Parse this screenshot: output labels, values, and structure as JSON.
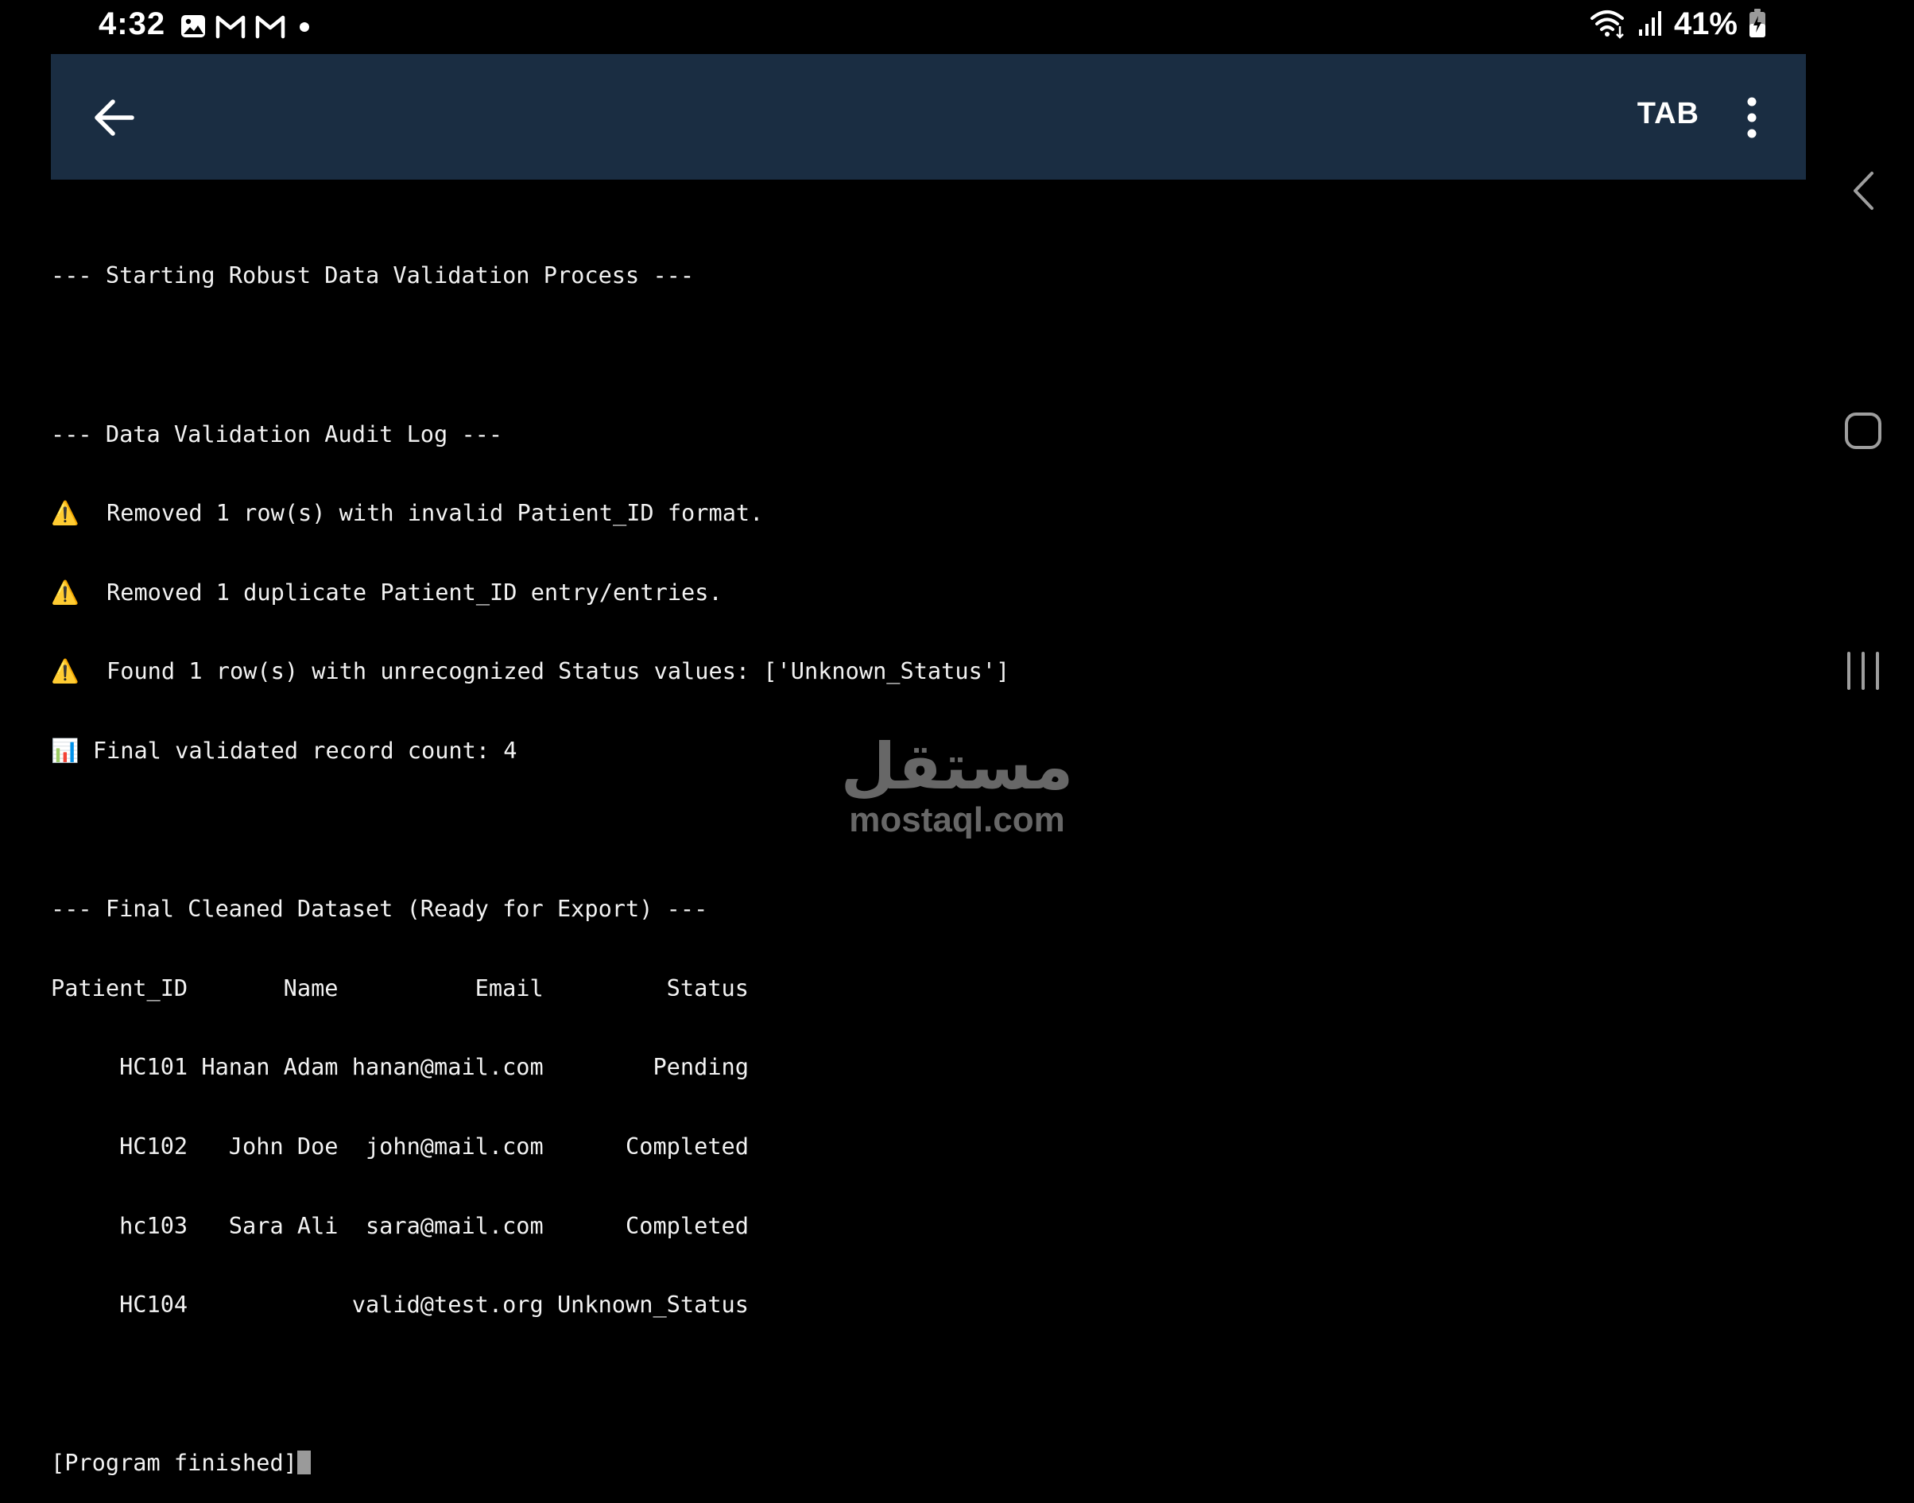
{
  "status_bar": {
    "time": "4:32",
    "battery": "41%",
    "notification_icons": [
      "image-icon",
      "gmail-icon",
      "gmail-icon",
      "dot-icon"
    ],
    "system_icons": [
      "wifi-icon",
      "signal-icon",
      "battery-charging-icon"
    ]
  },
  "app_bar": {
    "background": "#1a2d42",
    "back_icon": "arrow-left-icon",
    "tab_label": "TAB",
    "more_icon": "more-vertical-icon"
  },
  "terminal": {
    "lines": [
      "--- Starting Robust Data Validation Process ---",
      "",
      "--- Data Validation Audit Log ---",
      "⚠️  Removed 1 row(s) with invalid Patient_ID format.",
      "⚠️  Removed 1 duplicate Patient_ID entry/entries.",
      "⚠️  Found 1 row(s) with unrecognized Status values: ['Unknown_Status']",
      "📊 Final validated record count: 4",
      "",
      "--- Final Cleaned Dataset (Ready for Export) ---",
      "Patient_ID       Name          Email         Status",
      "     HC101 Hanan Adam hanan@mail.com        Pending",
      "     HC102   John Doe  john@mail.com      Completed",
      "     hc103   Sara Ali  sara@mail.com      Completed",
      "     HC104            valid@test.org Unknown_Status",
      "",
      "[Program finished]"
    ]
  },
  "nav_bar": {
    "back_icon": "chevron-left-icon",
    "home_icon": "home-square-icon",
    "recents_icon": "recents-icon"
  },
  "watermark": {
    "arabic": "مستقل",
    "latin": "mostaql.com"
  }
}
